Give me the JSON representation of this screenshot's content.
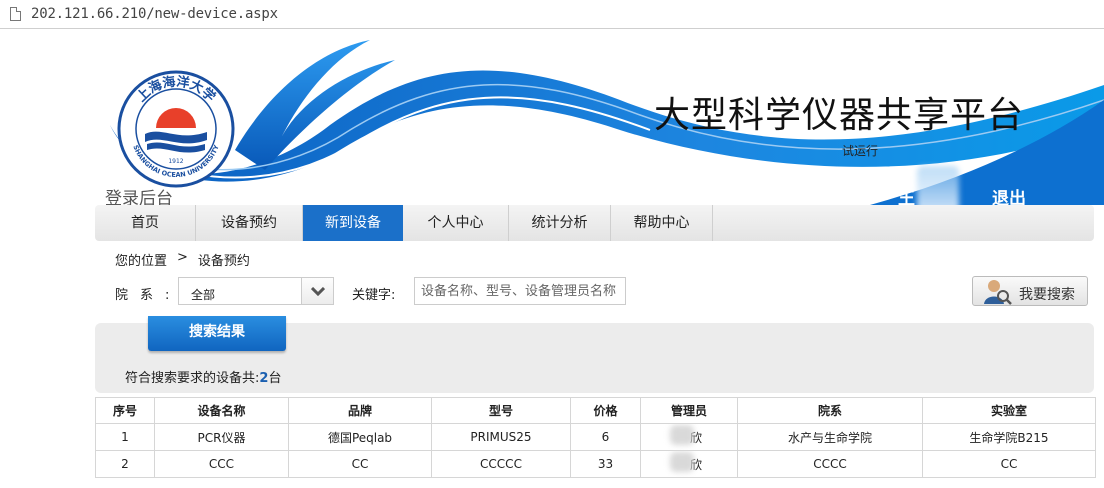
{
  "browser": {
    "url": "202.121.66.210/new-device.aspx"
  },
  "header": {
    "title": "大型科学仪器共享平台",
    "subtitle": "试运行",
    "backend_link": "登录后台",
    "user_name": "王",
    "logout": "退出",
    "logo_text_top": "上海海洋大学",
    "logo_text_bottom": "SHANGHAI OCEAN UNIVERSITY",
    "logo_year": "1912"
  },
  "nav": {
    "items": [
      {
        "label": "首页"
      },
      {
        "label": "设备预约"
      },
      {
        "label": "新到设备"
      },
      {
        "label": "个人中心"
      },
      {
        "label": "统计分析"
      },
      {
        "label": "帮助中心"
      }
    ],
    "active_label": "新到设备"
  },
  "breadcrumb": {
    "prefix": "您的位置",
    "separator": ">",
    "current": "设备预约"
  },
  "search": {
    "dept_label": "院系:",
    "dept_value": "全部",
    "keyword_label": "关键字:",
    "keyword_placeholder": "设备名称、型号、设备管理员名称",
    "button_label": "我要搜索"
  },
  "results": {
    "tab_label": "搜索结果",
    "count_prefix": "符合搜索要求的设备共:",
    "count": "2",
    "count_suffix": "台"
  },
  "table": {
    "headers": [
      "序号",
      "设备名称",
      "品牌",
      "型号",
      "价格",
      "管理员",
      "院系",
      "实验室"
    ],
    "rows": [
      [
        "1",
        "PCR仪器",
        "德国Peqlab",
        "PRIMUS25",
        "6",
        "欣",
        "水产与生命学院",
        "生命学院B215"
      ],
      [
        "2",
        "CCC",
        "CC",
        "CCCCC",
        "33",
        "欣",
        "CCCC",
        "CC"
      ]
    ]
  },
  "colors": {
    "brand_blue": "#1b70c9",
    "wave_blue": "#0a64c8",
    "nav_bg": "#e8e8e8"
  }
}
